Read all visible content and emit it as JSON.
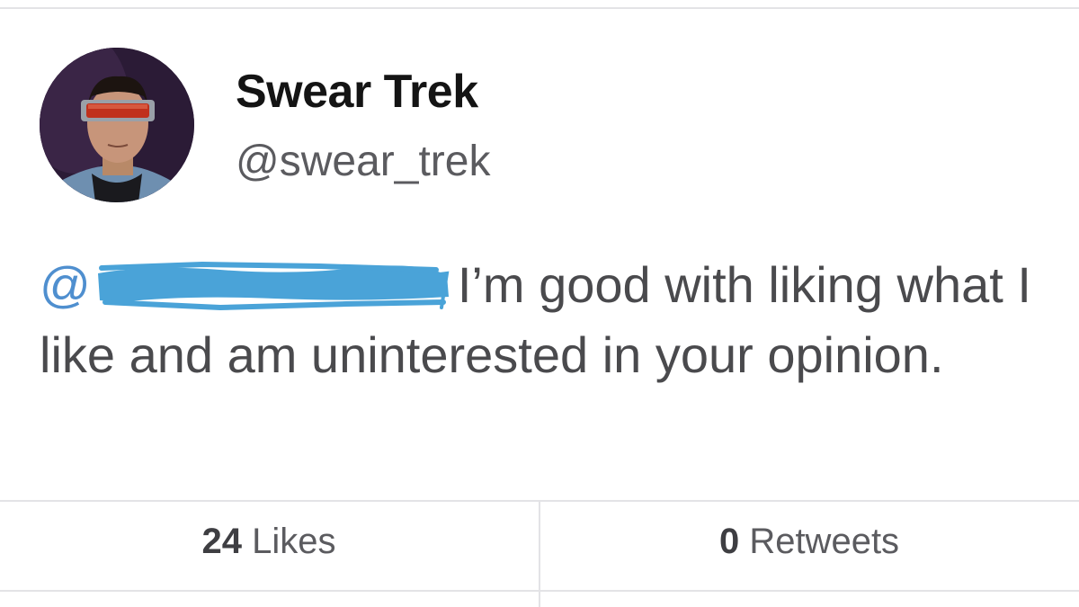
{
  "profile": {
    "display_name": "Swear Trek",
    "handle": "@swear_trek",
    "avatar_icon": "profile-photo"
  },
  "tweet": {
    "mention_prefix": "@",
    "redaction_color": "#4aa3d8",
    "text": "I’m good with liking what I like and am uninterested in your opinion."
  },
  "stats": {
    "likes_count": "24",
    "likes_label": "Likes",
    "retweets_count": "0",
    "retweets_label": "Retweets"
  },
  "colors": {
    "mention": "#4f8fcf",
    "text": "#4a4a4d",
    "name": "#141414",
    "rule": "#e3e3e6"
  }
}
